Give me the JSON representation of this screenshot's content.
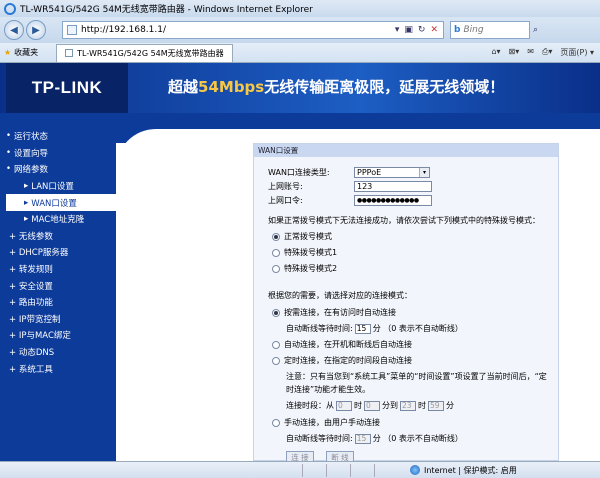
{
  "window": {
    "title": "TL-WR541G/542G 54M无线宽带路由器 - Windows Internet Explorer"
  },
  "address": {
    "url": "http://192.168.1.1/"
  },
  "search": {
    "placeholder": "Bing"
  },
  "favorites": {
    "label": "收藏夹",
    "tab_title": "TL-WR541G/542G 54M无线宽带路由器",
    "page_menu": "页面(P) ▾"
  },
  "banner": {
    "logo": "TP-LINK",
    "slogan_prefix": "超越",
    "slogan_highlight": "54Mbps",
    "slogan_suffix": "无线传输距离极限，延展无线领域！"
  },
  "menu": [
    {
      "label": "运行状态",
      "level": 0,
      "active": false
    },
    {
      "label": "设置向导",
      "level": 0,
      "active": false
    },
    {
      "label": "网络参数",
      "level": 0,
      "active": false
    },
    {
      "label": "LAN口设置",
      "level": 1,
      "active": false
    },
    {
      "label": "WAN口设置",
      "level": 1,
      "active": true
    },
    {
      "label": "MAC地址克隆",
      "level": 1,
      "active": false
    },
    {
      "label": "+ 无线参数",
      "level": 0,
      "active": false
    },
    {
      "label": "+ DHCP服务器",
      "level": 0,
      "active": false
    },
    {
      "label": "+ 转发规则",
      "level": 0,
      "active": false
    },
    {
      "label": "+ 安全设置",
      "level": 0,
      "active": false
    },
    {
      "label": "+ 路由功能",
      "level": 0,
      "active": false
    },
    {
      "label": "+ IP带宽控制",
      "level": 0,
      "active": false
    },
    {
      "label": "+ IP与MAC绑定",
      "level": 0,
      "active": false
    },
    {
      "label": "+ 动态DNS",
      "level": 0,
      "active": false
    },
    {
      "label": "+ 系统工具",
      "level": 0,
      "active": false
    }
  ],
  "panel": {
    "title": "WAN口设置",
    "conn_type_label": "WAN口连接类型:",
    "conn_type_value": "PPPoE",
    "account_label": "上网账号:",
    "account_value": "123",
    "password_label": "上网口令:",
    "password_value": "●●●●●●●●●●●●●",
    "special_hint": "如果正常拨号模式下无法连接成功，请依次尝试下列模式中的特殊拨号模式：",
    "dial_modes": [
      "正常拨号模式",
      "特殊拨号模式1",
      "特殊拨号模式2"
    ],
    "mode_hint": "根据您的需要，请选择对应的连接模式：",
    "on_demand": "按需连接，在有访问时自动连接",
    "idle_label": "自动断线等待时间:",
    "idle_value": "15",
    "idle_unit": "分 （0 表示不自动断线）",
    "auto_connect": "自动连接，在开机和断线后自动连接",
    "timed_connect": "定时连接，在指定的时间段自动连接",
    "note_line1": "注意：只有当您到“系统工具”菜单的“时间设置”项设置了当前时间后，“定",
    "note_line2": "时连接”功能才能生效。",
    "period_label": "连接时段：从",
    "period_h1": "0",
    "period_t1": "时",
    "period_m1": "0",
    "period_t2": "分到",
    "period_h2": "23",
    "period_t3": "时",
    "period_m2": "59",
    "period_t4": "分",
    "manual_connect": "手动连接，由用户手动连接",
    "manual_idle_value": "15",
    "btn_connect": "连 接",
    "btn_disconnect": "断 线"
  },
  "status": {
    "zone": "Internet | 保护模式: 启用"
  }
}
